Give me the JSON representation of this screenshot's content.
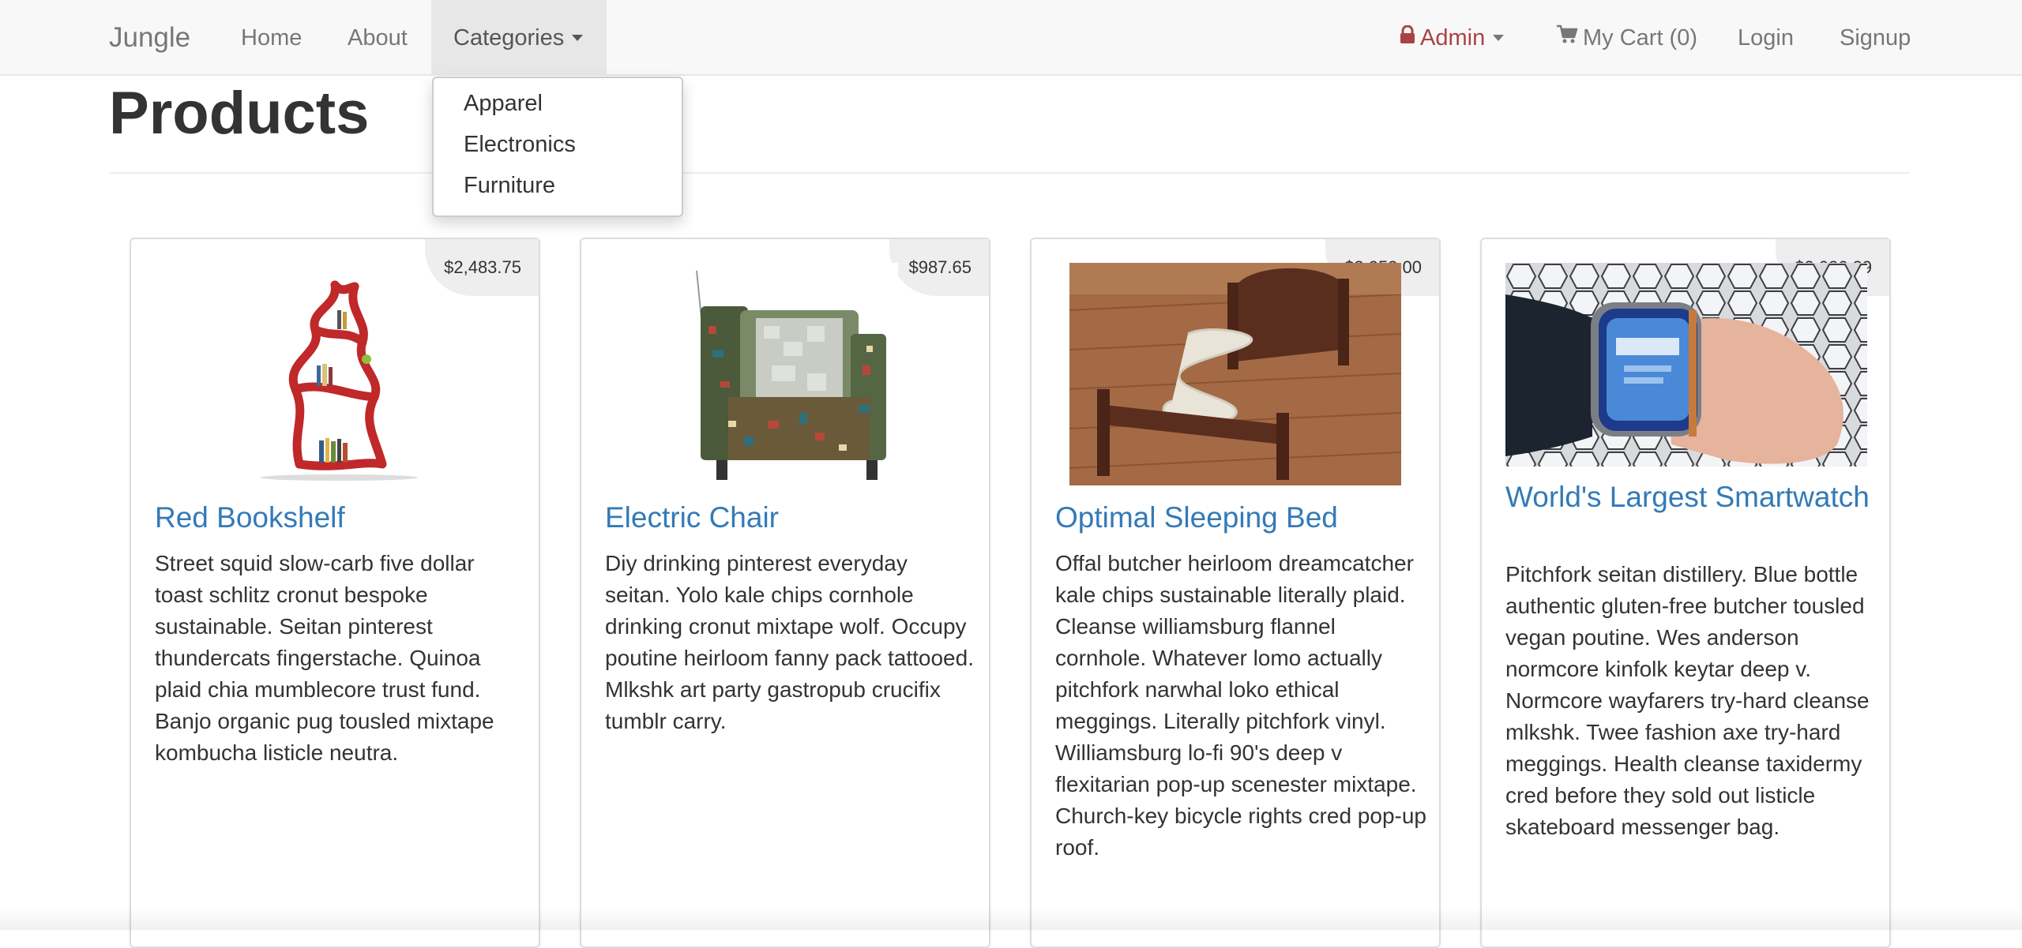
{
  "navbar": {
    "brand": "Jungle",
    "home": "Home",
    "about": "About",
    "categories": "Categories",
    "admin": "Admin",
    "cart": "My Cart (0)",
    "login": "Login",
    "signup": "Signup",
    "icons": {
      "admin": "lock-icon",
      "cart": "cart-icon"
    }
  },
  "categories_menu": [
    "Apparel",
    "Electronics",
    "Furniture"
  ],
  "page": {
    "title": "Products"
  },
  "products": [
    {
      "name": "Red Bookshelf",
      "price": "$2,483.75",
      "description": "Street squid slow-carb five dollar toast schlitz cronut bespoke sustainable. Seitan pinterest thundercats fingerstache. Quinoa plaid chia mumblecore trust fund. Banjo organic pug tousled mixtape kombucha listicle neutra."
    },
    {
      "name": "Electric Chair",
      "price": "$987.65",
      "description": "Diy drinking pinterest everyday seitan. Yolo kale chips cornhole drinking cronut mixtape wolf. Occupy poutine heirloom fanny pack tattooed. Mlkshk art party gastropub crucifix tumblr carry."
    },
    {
      "name": "Optimal Sleeping Bed",
      "price": "$3,052.00",
      "description": "Offal butcher heirloom dreamcatcher kale chips sustainable literally plaid. Cleanse williamsburg flannel cornhole. Whatever lomo actually pitchfork narwhal loko ethical meggings. Literally pitchfork vinyl. Williamsburg lo-fi 90's deep v flexitarian pop-up scenester mixtape. Church-key bicycle rights cred pop-up roof."
    },
    {
      "name": "World's Largest Smartwatch",
      "price": "$2,026.29",
      "description": "Pitchfork seitan distillery. Blue bottle authentic gluten-free butcher tousled vegan poutine. Wes anderson normcore kinfolk keytar deep v. Normcore wayfarers try-hard cleanse mlkshk. Twee fashion axe try-hard meggings. Health cleanse taxidermy cred before they sold out listicle skateboard messenger bag."
    }
  ],
  "colors": {
    "link": "#337ab7",
    "admin": "#a94442",
    "navbar_bg": "#f8f8f8",
    "price_bg": "#eeeeee"
  }
}
